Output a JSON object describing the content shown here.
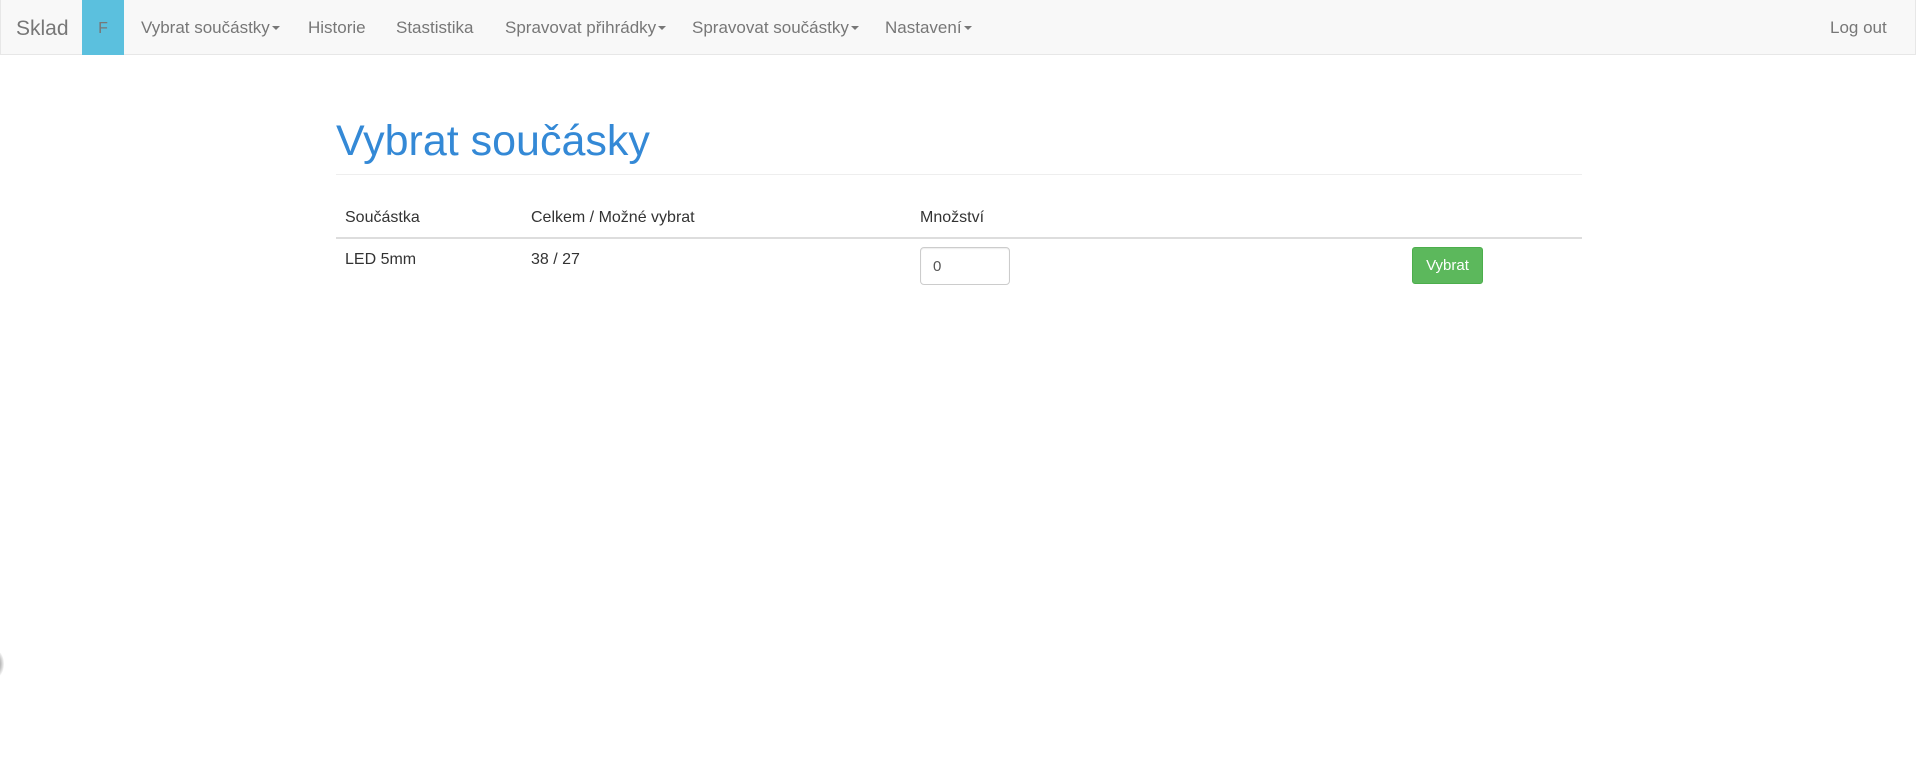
{
  "navbar": {
    "brand": "Sklad",
    "badge": "F",
    "items": [
      {
        "label": "Vybrat součástky",
        "dropdown": true
      },
      {
        "label": "Historie",
        "dropdown": false
      },
      {
        "label": "Stastistika",
        "dropdown": false
      },
      {
        "label": "Spravovat přihrádky",
        "dropdown": true
      },
      {
        "label": "Spravovat součástky",
        "dropdown": true
      },
      {
        "label": "Nastavení",
        "dropdown": true
      }
    ],
    "logout": "Log out"
  },
  "page": {
    "title": "Vybrat součásky"
  },
  "table": {
    "headers": {
      "part": "Součástka",
      "totals": "Celkem / Možné vybrat",
      "quantity": "Množství"
    },
    "rows": [
      {
        "part": "LED 5mm",
        "totals": "38 / 27",
        "quantity": "0",
        "action": "Vybrat"
      }
    ]
  },
  "colors": {
    "title": "#3489d6",
    "badge": "#5bc0de",
    "success": "#5cb85c",
    "navbar_bg": "#f8f8f8"
  }
}
